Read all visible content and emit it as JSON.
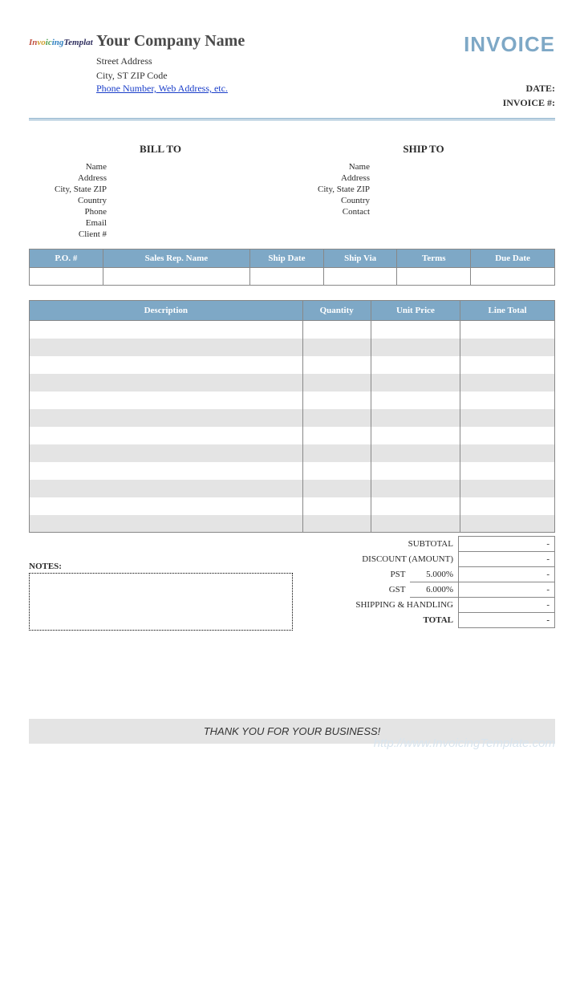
{
  "logo_text": "InvoicingTemplate",
  "company": {
    "name": "Your Company Name",
    "street": "Street Address",
    "city_line": "City, ST  ZIP Code",
    "contact_link": "Phone Number, Web Address, etc."
  },
  "title": "INVOICE",
  "meta": {
    "date_label": "DATE:",
    "invoice_no_label": "INVOICE #:"
  },
  "bill_to": {
    "heading": "BILL TO",
    "labels": [
      "Name",
      "Address",
      "City, State ZIP",
      "Country",
      "Phone",
      "Email",
      "Client #"
    ]
  },
  "ship_to": {
    "heading": "SHIP TO",
    "labels": [
      "Name",
      "Address",
      "City, State ZIP",
      "Country",
      "Contact"
    ]
  },
  "info_headers": [
    "P.O. #",
    "Sales Rep. Name",
    "Ship Date",
    "Ship Via",
    "Terms",
    "Due Date"
  ],
  "line_headers": [
    "Description",
    "Quantity",
    "Unit Price",
    "Line Total"
  ],
  "line_count": 12,
  "totals": {
    "subtotal_label": "SUBTOTAL",
    "discount_label": "DISCOUNT (AMOUNT)",
    "pst_label": "PST",
    "pst_rate": "5.000%",
    "gst_label": "GST",
    "gst_rate": "6.000%",
    "shipping_label": "SHIPPING & HANDLING",
    "total_label": "TOTAL",
    "dash": "-"
  },
  "notes_label": "NOTES:",
  "thanks": "THANK YOU FOR YOUR BUSINESS!",
  "watermark": "http://www.InvoicingTemplate.com"
}
